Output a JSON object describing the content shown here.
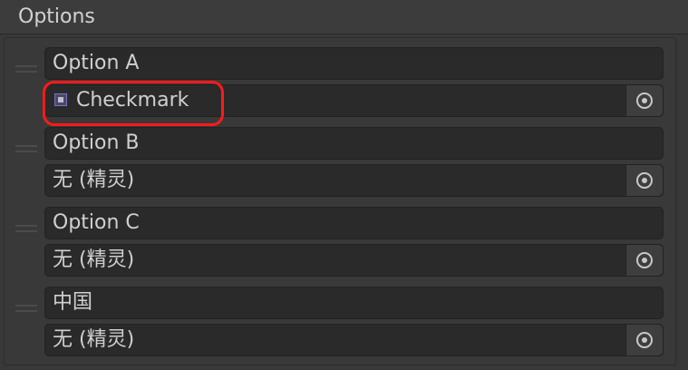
{
  "panel": {
    "title": "Options"
  },
  "entries": [
    {
      "name": "Option A",
      "sprite": "Checkmark",
      "has_thumbnail": true
    },
    {
      "name": "Option B",
      "sprite": "无 (精灵)",
      "has_thumbnail": false
    },
    {
      "name": "Option C",
      "sprite": "无 (精灵)",
      "has_thumbnail": false
    },
    {
      "name": "中国",
      "sprite": "无 (精灵)",
      "has_thumbnail": false
    }
  ],
  "icons": {
    "drag_handle": "drag-handle-icon",
    "object_picker": "object-picker-icon",
    "sprite_thumbnail": "sprite-thumbnail-icon"
  },
  "colors": {
    "background": "#383838",
    "field_background": "#2a2a2a",
    "highlight": "#ff1a1a"
  }
}
